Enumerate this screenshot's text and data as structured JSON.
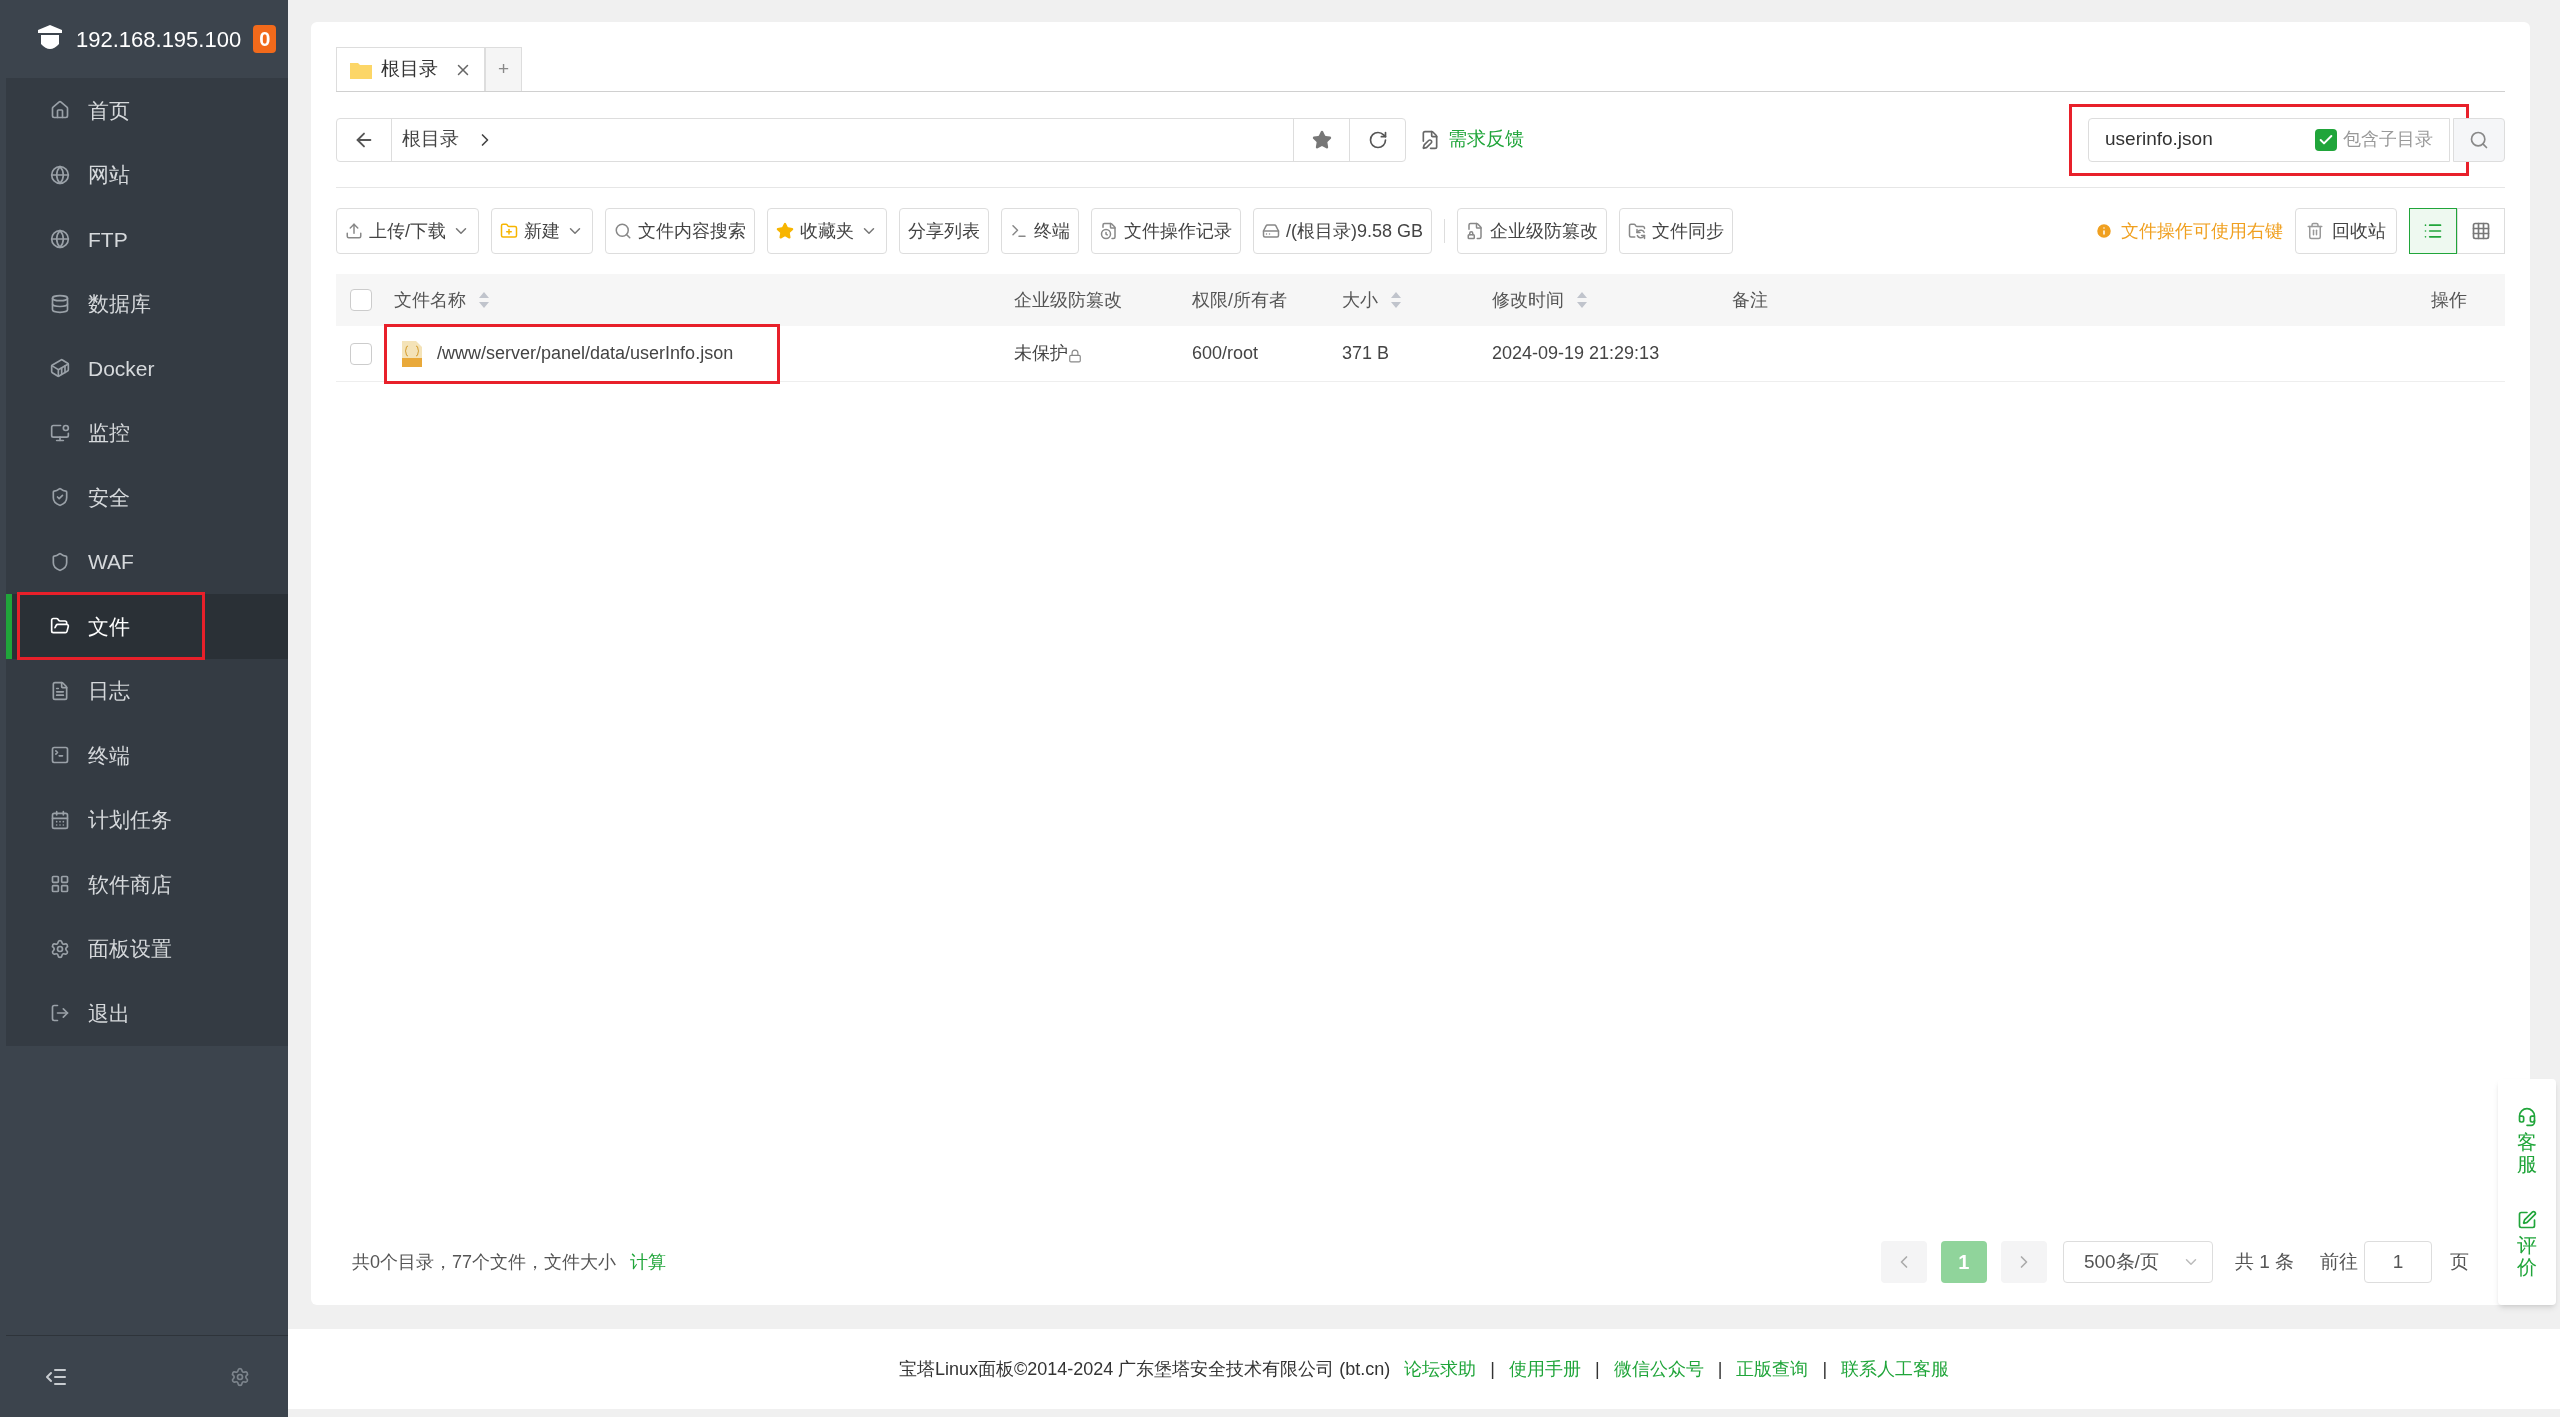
{
  "sidebar": {
    "host": "192.168.195.100",
    "badge": "0",
    "items": [
      {
        "label": "首页",
        "selected": false,
        "highlighted": false
      },
      {
        "label": "网站",
        "selected": false,
        "highlighted": false
      },
      {
        "label": "FTP",
        "selected": false,
        "highlighted": false
      },
      {
        "label": "数据库",
        "selected": false,
        "highlighted": false
      },
      {
        "label": "Docker",
        "selected": false,
        "highlighted": false
      },
      {
        "label": "监控",
        "selected": false,
        "highlighted": false
      },
      {
        "label": "安全",
        "selected": false,
        "highlighted": false
      },
      {
        "label": "WAF",
        "selected": false,
        "highlighted": false
      },
      {
        "label": "文件",
        "selected": true,
        "highlighted": true
      },
      {
        "label": "日志",
        "selected": false,
        "highlighted": false
      },
      {
        "label": "终端",
        "selected": false,
        "highlighted": false
      },
      {
        "label": "计划任务",
        "selected": false,
        "highlighted": false
      },
      {
        "label": "软件商店",
        "selected": false,
        "highlighted": false
      },
      {
        "label": "面板设置",
        "selected": false,
        "highlighted": false
      },
      {
        "label": "退出",
        "selected": false,
        "highlighted": false
      }
    ]
  },
  "tabs": [
    {
      "label": "根目录",
      "selected": true
    },
    {
      "label": "+",
      "selected": false
    }
  ],
  "path_bar": {
    "crumbs": [
      "根目录"
    ],
    "feedback": "需求反馈"
  },
  "search": {
    "value": "userinfo.json",
    "subdir_label": "包含子目录",
    "subdir_checked": true,
    "highlighted": true
  },
  "toolbar": [
    {
      "label": "上传/下载",
      "dropdown": true
    },
    {
      "label": "新建",
      "dropdown": true
    },
    {
      "label": "文件内容搜索",
      "dropdown": false
    },
    {
      "label": "收藏夹",
      "dropdown": true
    },
    {
      "label": "分享列表",
      "dropdown": false
    },
    {
      "label": "终端",
      "dropdown": false
    },
    {
      "label": "文件操作记录",
      "dropdown": false
    },
    {
      "label": "/(根目录)9.58 GB",
      "dropdown": false
    },
    {
      "label": "企业级防篡改",
      "dropdown": false
    },
    {
      "label": "文件同步",
      "dropdown": false
    }
  ],
  "hint": "文件操作可使用右键",
  "recycle": "回收站",
  "views": [
    {
      "kind": "list",
      "selected": true
    },
    {
      "kind": "grid",
      "selected": false
    }
  ],
  "table": {
    "select_all_checked": false,
    "columns": [
      {
        "label": "文件名称",
        "sortable": true
      },
      {
        "label": "企业级防篡改",
        "sortable": false
      },
      {
        "label": "权限/所有者",
        "sortable": false
      },
      {
        "label": "大小",
        "sortable": true
      },
      {
        "label": "修改时间",
        "sortable": true
      },
      {
        "label": "备注",
        "sortable": false
      },
      {
        "label": "操作",
        "sortable": false
      }
    ],
    "rows": [
      {
        "checked": false,
        "highlighted": true,
        "name": "/www/server/panel/data/userInfo.json",
        "protection": "未保护",
        "permission": "600/root",
        "size": "371 B",
        "modified": "2024-09-19 21:29:13"
      }
    ]
  },
  "summary": {
    "text": "共0个目录，77个文件，文件大小",
    "link": "计算"
  },
  "pagination": {
    "pages": [
      {
        "label": "1",
        "selected": true
      }
    ],
    "page_size": "500条/页",
    "total": "共 1 条",
    "goto": "前往",
    "goto_value": "1",
    "page_unit": "页"
  },
  "float": [
    {
      "kind": "service",
      "label": "客服"
    },
    {
      "kind": "review",
      "label": "评价"
    }
  ],
  "footer": {
    "text": "宝塔Linux面板©2014-2024 广东堡塔安全技术有限公司 (bt.cn)",
    "links": [
      {
        "text": "论坛求助"
      },
      {
        "separator": "|",
        "text": "使用手册"
      },
      {
        "separator": "|",
        "text": "微信公众号"
      },
      {
        "separator": "|",
        "text": "正版查询"
      },
      {
        "separator": "|",
        "text": "联系人工客服"
      }
    ]
  }
}
